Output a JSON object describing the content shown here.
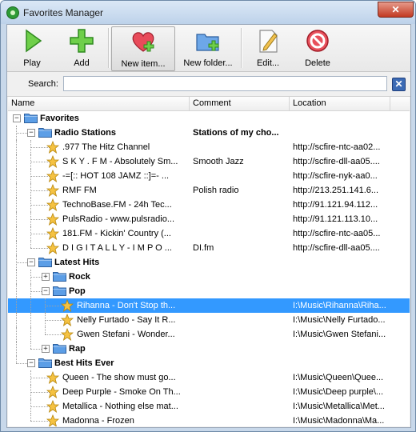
{
  "window": {
    "title": "Favorites Manager",
    "close_glyph": "✕"
  },
  "toolbar": {
    "play": "Play",
    "add": "Add",
    "new_item": "New item...",
    "new_folder": "New folder...",
    "edit": "Edit...",
    "delete": "Delete"
  },
  "search": {
    "label": "Search:",
    "value": "",
    "placeholder": "",
    "clear_glyph": "✕"
  },
  "columns": {
    "name": "Name",
    "comment": "Comment",
    "location": "Location"
  },
  "colors": {
    "selection": "#3399ff",
    "folder": "#5c9ee6",
    "star": "#f5c242"
  },
  "rows": [
    {
      "type": "folder",
      "depth": 0,
      "expanded": true,
      "name": "Favorites",
      "comment": "",
      "location": ""
    },
    {
      "type": "folder",
      "depth": 1,
      "expanded": true,
      "name": "Radio Stations",
      "comment": "Stations of my cho...",
      "location": ""
    },
    {
      "type": "item",
      "depth": 2,
      "name": ".977 The Hitz Channel",
      "comment": "",
      "location": "http://scfire-ntc-aa02..."
    },
    {
      "type": "item",
      "depth": 2,
      "name": "S K Y . F M - Absolutely Sm...",
      "comment": "Smooth Jazz",
      "location": "http://scfire-dll-aa05...."
    },
    {
      "type": "item",
      "depth": 2,
      "name": "-=[:: HOT 108 JAMZ ::]=- ...",
      "comment": "",
      "location": "http://scfire-nyk-aa0..."
    },
    {
      "type": "item",
      "depth": 2,
      "name": "RMF FM",
      "comment": "Polish radio",
      "location": "http://213.251.141.6..."
    },
    {
      "type": "item",
      "depth": 2,
      "name": "TechnoBase.FM - 24h Tec...",
      "comment": "",
      "location": "http://91.121.94.112..."
    },
    {
      "type": "item",
      "depth": 2,
      "name": "PulsRadio - www.pulsradio...",
      "comment": "",
      "location": "http://91.121.113.10..."
    },
    {
      "type": "item",
      "depth": 2,
      "name": "181.FM - Kickin' Country (...",
      "comment": "",
      "location": "http://scfire-ntc-aa05..."
    },
    {
      "type": "item",
      "depth": 2,
      "name": "D I G I T A L L Y - I M P O ...",
      "comment": "DI.fm",
      "location": "http://scfire-dll-aa05...."
    },
    {
      "type": "folder",
      "depth": 1,
      "expanded": true,
      "name": "Latest Hits",
      "comment": "",
      "location": ""
    },
    {
      "type": "folder",
      "depth": 2,
      "expanded": false,
      "name": "Rock",
      "comment": "",
      "location": ""
    },
    {
      "type": "folder",
      "depth": 2,
      "expanded": true,
      "name": "Pop",
      "comment": "",
      "location": ""
    },
    {
      "type": "item",
      "depth": 3,
      "selected": true,
      "name": "Rihanna - Don't Stop th...",
      "comment": "",
      "location": "I:\\Music\\Rihanna\\Riha..."
    },
    {
      "type": "item",
      "depth": 3,
      "name": "Nelly Furtado - Say It R...",
      "comment": "",
      "location": "I:\\Music\\Nelly Furtado..."
    },
    {
      "type": "item",
      "depth": 3,
      "name": "Gwen Stefani - Wonder...",
      "comment": "",
      "location": "I:\\Music\\Gwen Stefani..."
    },
    {
      "type": "folder",
      "depth": 2,
      "expanded": false,
      "name": "Rap",
      "comment": "",
      "location": ""
    },
    {
      "type": "folder",
      "depth": 1,
      "expanded": true,
      "name": "Best Hits Ever",
      "comment": "",
      "location": ""
    },
    {
      "type": "item",
      "depth": 2,
      "name": "Queen - The show must go...",
      "comment": "",
      "location": "I:\\Music\\Queen\\Quee..."
    },
    {
      "type": "item",
      "depth": 2,
      "name": "Deep Purple - Smoke On Th...",
      "comment": "",
      "location": "I:\\Music\\Deep purple\\..."
    },
    {
      "type": "item",
      "depth": 2,
      "name": "Metallica - Nothing else mat...",
      "comment": "",
      "location": "I:\\Music\\Metallica\\Met..."
    },
    {
      "type": "item",
      "depth": 2,
      "name": "Madonna - Frozen",
      "comment": "",
      "location": "I:\\Music\\Madonna\\Ma..."
    }
  ]
}
